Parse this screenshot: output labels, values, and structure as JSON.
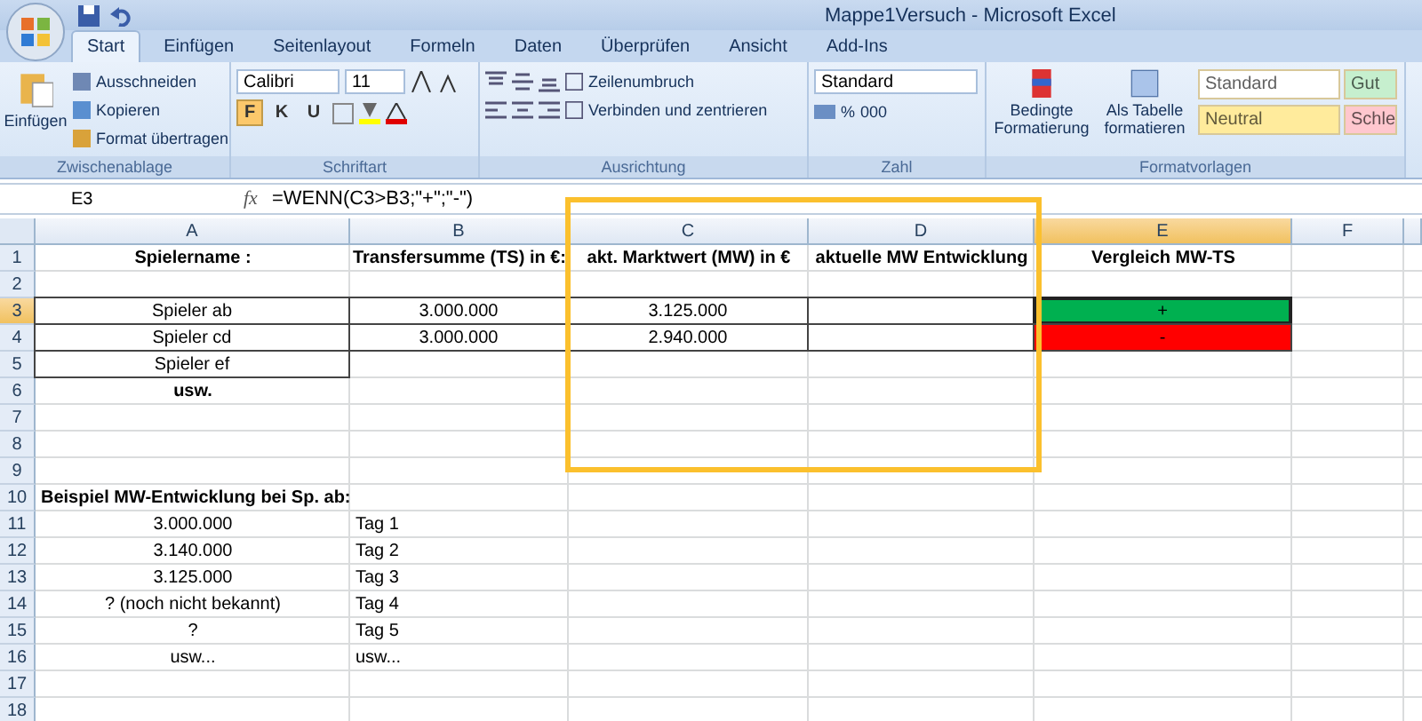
{
  "window": {
    "title": "Mappe1Versuch - Microsoft Excel"
  },
  "tabs": [
    {
      "label": "Start",
      "selected": true
    },
    {
      "label": "Einfügen",
      "selected": false
    },
    {
      "label": "Seitenlayout",
      "selected": false
    },
    {
      "label": "Formeln",
      "selected": false
    },
    {
      "label": "Daten",
      "selected": false
    },
    {
      "label": "Überprüfen",
      "selected": false
    },
    {
      "label": "Ansicht",
      "selected": false
    },
    {
      "label": "Add-Ins",
      "selected": false
    }
  ],
  "ribbon": {
    "clipboard": {
      "label": "Zwischenablage",
      "paste": "Einfügen",
      "items": [
        "Ausschneiden",
        "Kopieren",
        "Format übertragen"
      ]
    },
    "font": {
      "label": "Schriftart",
      "family": "Calibri",
      "size": "11",
      "styles": [
        {
          "text": "F",
          "on": true
        },
        {
          "text": "K",
          "on": false
        },
        {
          "text": "U",
          "on": false
        }
      ]
    },
    "alignment": {
      "label": "Ausrichtung",
      "wrap": "Zeilenumbruch",
      "merge": "Verbinden und zentrieren"
    },
    "number": {
      "label": "Zahl",
      "format": "Standard",
      "percent": "%",
      "thousands": "000"
    },
    "styles": {
      "label": "Formatvorlagen",
      "conditional": "Bedingte Formatierung",
      "as_table": "Als Tabelle formatieren",
      "cell_styles": [
        {
          "text": "Standard",
          "color": "#ffffff"
        },
        {
          "text": "Gut",
          "color": "#c6efce"
        },
        {
          "text": "Neutral",
          "color": "#ffeb9c"
        },
        {
          "text": "Schle",
          "color": "#ffc7ce"
        }
      ]
    }
  },
  "formula_bar": {
    "name_box": "E3",
    "function_label": "fx",
    "formula": "=WENN(C3>B3;\"+\";\"-\")"
  },
  "columns": [
    {
      "label": "A",
      "selected": false
    },
    {
      "label": "B",
      "selected": false
    },
    {
      "label": "C",
      "selected": false
    },
    {
      "label": "D",
      "selected": false
    },
    {
      "label": "E",
      "selected": true
    },
    {
      "label": "F",
      "selected": false
    }
  ],
  "rows": [
    {
      "number": "1",
      "selected": false,
      "A": {
        "text": "Spielername :",
        "bold": true,
        "kind": "centered",
        "bordered": false
      },
      "B": {
        "text": "Transfersumme (TS) in €:",
        "bold": true,
        "kind": "centered",
        "bordered": false
      },
      "C": {
        "text": "akt. Marktwert (MW) in €",
        "bold": true,
        "kind": "centered",
        "bordered": false
      },
      "D": {
        "text": "aktuelle MW Entwicklung",
        "bold": true,
        "kind": "centered",
        "bordered": false
      },
      "E": {
        "text": "Vergleich MW-TS",
        "bold": true,
        "kind": "centered",
        "bordered": false
      }
    },
    {
      "number": "2",
      "selected": false
    },
    {
      "number": "3",
      "selected": true,
      "A": {
        "text": "Spieler ab",
        "bold": false,
        "kind": "centered",
        "bordered": true
      },
      "B": {
        "text": "3.000.000",
        "bold": false,
        "kind": "centered",
        "bordered": true
      },
      "C": {
        "text": "3.125.000",
        "bold": false,
        "kind": "centered",
        "bordered": true
      },
      "D": {
        "bordered": true
      },
      "E": {
        "text": "+",
        "bold": false,
        "kind": "centered",
        "bordered": true,
        "color": "#00b050"
      }
    },
    {
      "number": "4",
      "selected": false,
      "A": {
        "text": "Spieler cd",
        "bold": false,
        "kind": "centered",
        "bordered": true
      },
      "B": {
        "text": "3.000.000",
        "bold": false,
        "kind": "centered",
        "bordered": true
      },
      "C": {
        "text": "2.940.000",
        "bold": false,
        "kind": "centered",
        "bordered": true
      },
      "D": {
        "bordered": true
      },
      "E": {
        "text": "-",
        "bold": false,
        "kind": "centered",
        "bordered": true,
        "color": "#ff0000"
      }
    },
    {
      "number": "5",
      "selected": false,
      "A": {
        "text": "Spieler ef",
        "bold": false,
        "kind": "centered",
        "bordered": true
      }
    },
    {
      "number": "6",
      "selected": false,
      "A": {
        "text": "usw.",
        "bold": true,
        "kind": "centered",
        "bordered": false
      }
    },
    {
      "number": "7",
      "selected": false
    },
    {
      "number": "8",
      "selected": false
    },
    {
      "number": "9",
      "selected": false
    },
    {
      "number": "10",
      "selected": false,
      "A": {
        "text": "Beispiel MW-Entwicklung bei Sp. ab:",
        "bold": true,
        "kind": "left",
        "bordered": false
      }
    },
    {
      "number": "11",
      "selected": false,
      "A": {
        "text": "3.000.000",
        "bold": false,
        "kind": "centered",
        "bordered": false
      },
      "B": {
        "text": "Tag 1",
        "bold": false,
        "kind": "left",
        "bordered": false
      }
    },
    {
      "number": "12",
      "selected": false,
      "A": {
        "text": "3.140.000",
        "bold": false,
        "kind": "centered",
        "bordered": false
      },
      "B": {
        "text": "Tag 2",
        "bold": false,
        "kind": "left",
        "bordered": false
      }
    },
    {
      "number": "13",
      "selected": false,
      "A": {
        "text": "3.125.000",
        "bold": false,
        "kind": "centered",
        "bordered": false
      },
      "B": {
        "text": "Tag 3",
        "bold": false,
        "kind": "left",
        "bordered": false
      }
    },
    {
      "number": "14",
      "selected": false,
      "A": {
        "text": "? (noch nicht bekannt)",
        "bold": false,
        "kind": "centered",
        "bordered": false
      },
      "B": {
        "text": "Tag 4",
        "bold": false,
        "kind": "left",
        "bordered": false
      }
    },
    {
      "number": "15",
      "selected": false,
      "A": {
        "text": "?",
        "bold": false,
        "kind": "centered",
        "bordered": false
      },
      "B": {
        "text": "Tag 5",
        "bold": false,
        "kind": "left",
        "bordered": false
      }
    },
    {
      "number": "16",
      "selected": false,
      "A": {
        "text": "usw...",
        "bold": false,
        "kind": "centered",
        "bordered": false
      },
      "B": {
        "text": "usw...",
        "bold": false,
        "kind": "left",
        "bordered": false
      }
    },
    {
      "number": "17",
      "selected": false
    },
    {
      "number": "18",
      "selected": false
    }
  ]
}
